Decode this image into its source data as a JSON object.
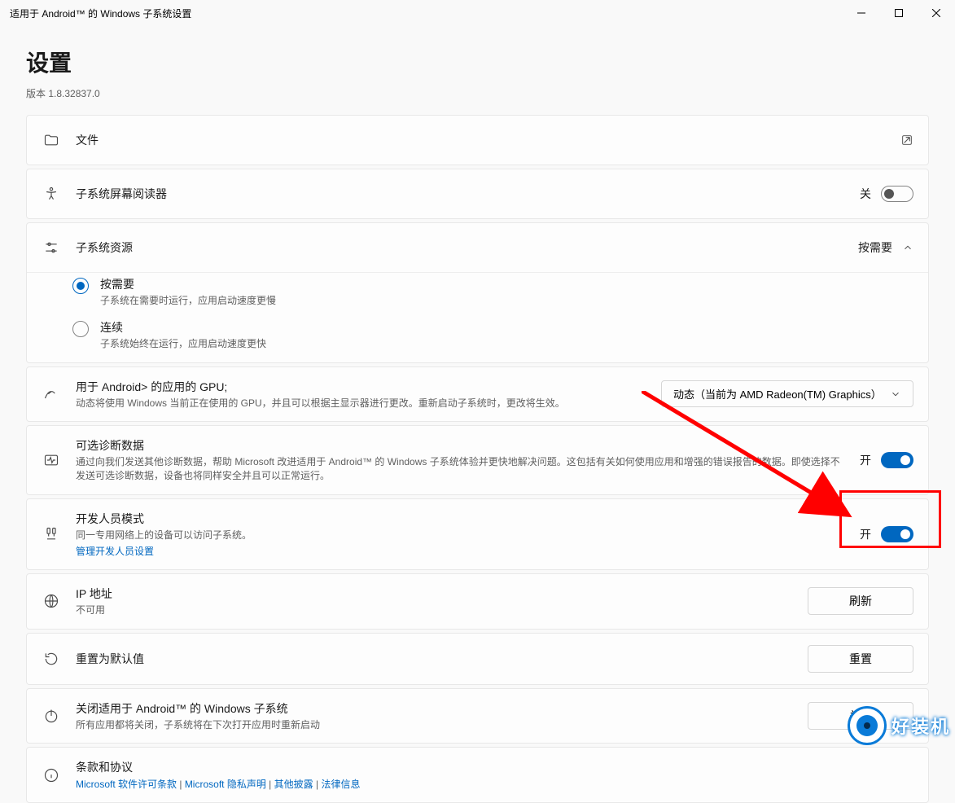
{
  "window": {
    "title": "适用于 Android™ 的 Windows 子系统设置"
  },
  "header": {
    "title": "设置",
    "version": "版本 1.8.32837.0"
  },
  "files": {
    "label": "文件"
  },
  "screenreader": {
    "label": "子系统屏幕阅读器",
    "state": "关"
  },
  "resources": {
    "label": "子系统资源",
    "value": "按需要",
    "opt1": {
      "title": "按需要",
      "desc": "子系统在需要时运行，应用启动速度更慢"
    },
    "opt2": {
      "title": "连续",
      "desc": "子系统始终在运行，应用启动速度更快"
    }
  },
  "gpu": {
    "title": "用于 Android> 的应用的 GPU;",
    "desc": "动态将使用 Windows 当前正在使用的 GPU，并且可以根据主显示器进行更改。重新启动子系统时，更改将生效。",
    "selected": "动态（当前为 AMD Radeon(TM) Graphics）"
  },
  "diag": {
    "title": "可选诊断数据",
    "desc": "通过向我们发送其他诊断数据，帮助 Microsoft 改进适用于 Android™ 的 Windows 子系统体验并更快地解决问题。这包括有关如何使用应用和增强的错误报告的数据。即使选择不发送可选诊断数据，设备也将同样安全并且可以正常运行。",
    "state": "开"
  },
  "dev": {
    "title": "开发人员模式",
    "desc": "同一专用网络上的设备可以访问子系统。",
    "link": "管理开发人员设置",
    "state": "开"
  },
  "ip": {
    "title": "IP 地址",
    "desc": "不可用",
    "btn": "刷新"
  },
  "reset": {
    "title": "重置为默认值",
    "btn": "重置"
  },
  "shutdown": {
    "title": "关闭适用于 Android™ 的 Windows 子系统",
    "desc": "所有应用都将关闭，子系统将在下次打开应用时重新启动",
    "btn": "关闭"
  },
  "terms": {
    "title": "条款和协议",
    "l1": "Microsoft 软件许可条款",
    "l2": "Microsoft 隐私声明",
    "l3": "其他披露",
    "l4": "法律信息",
    "sep": " | "
  },
  "watermark": {
    "text": "好装机"
  }
}
